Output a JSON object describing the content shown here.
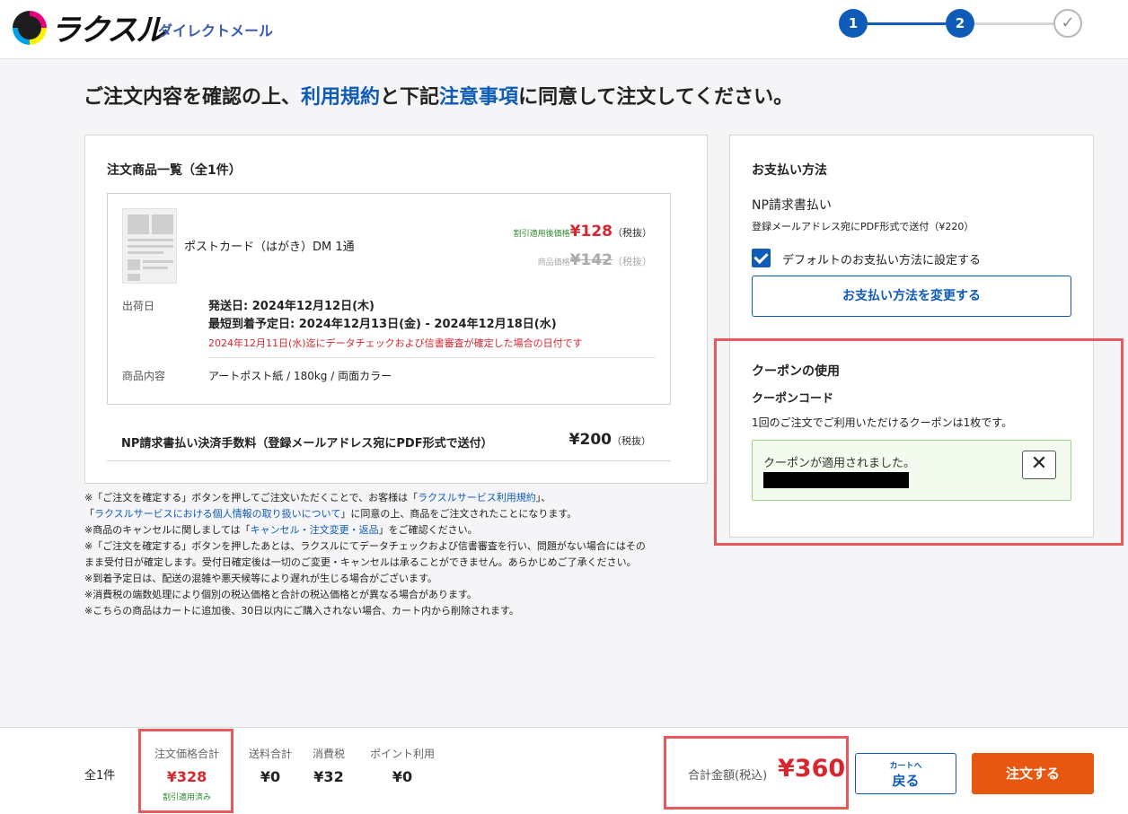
{
  "header": {
    "logo_text": "ラクスル",
    "logo_sub": "ダイレクトメール",
    "steps": [
      "1",
      "2",
      "✓"
    ]
  },
  "title": {
    "prefix": "ご注文内容を確認の上、",
    "link1": "利用規約",
    "mid": "と下記",
    "link2": "注意事項",
    "suffix": "に同意して注文してください。"
  },
  "order": {
    "heading": "注文商品一覧（全1件）",
    "item_name": "ポストカード（はがき）DM 1通",
    "discount_label": "割引適用後価格",
    "discount_price": "¥128",
    "tax_label": "（税抜）",
    "orig_label": "商品価格",
    "orig_price": "¥142",
    "ship_label": "出荷日",
    "ship_date": "発送日: 2024年12月12日(木)",
    "arrival_date": "最短到着予定日: 2024年12月13日(金) - 2024年12月18日(水)",
    "ship_note": "2024年12月11日(水)迄にデータチェックおよび信書審査が確定した場合の日付です",
    "content_label": "商品内容",
    "content_value": "アートポスト紙 / 180kg / 両面カラー",
    "fee_label": "NP請求書払い決済手数料（登録メールアドレス宛にPDF形式で送付）",
    "fee_value": "¥200",
    "fee_tax": "（税抜）"
  },
  "notes": {
    "l1a": "※「ご注文を確定する」ボタンを押してご注文いただくことで、お客様は「",
    "l1link": "ラクスルサービス利用規約",
    "l1b": "」、",
    "l2a": "「",
    "l2link": "ラクスルサービスにおける個人情報の取り扱いについて",
    "l2b": "」に同意の上、商品をご注文されたことになります。",
    "l3a": "※商品のキャンセルに関しましては「",
    "l3link": "キャンセル・注文変更・返品",
    "l3b": "」をご確認ください。",
    "l4": "※「ご注文を確定する」ボタンを押したあとは、ラクスルにてデータチェックおよび信書審査を行い、問題がない場合にはその",
    "l5": "まま受付日が確定します。受付日確定後は一切のご変更・キャンセルは承ることができません。あらかじめご了承ください。",
    "l6": "※到着予定日は、配送の混雑や悪天候等により遅れが生じる場合がございます。",
    "l7": "※消費税の端数処理により個別の税込価格と合計の税込価格とが異なる場合があります。",
    "l8": "※こちらの商品はカートに追加後、30日以内にご購入されない場合、カート内から削除されます。"
  },
  "payment": {
    "heading": "お支払い方法",
    "method": "NP請求書払い",
    "detail": "登録メールアドレス宛にPDF形式で送付（¥220）",
    "default_label": "デフォルトのお支払い方法に設定する",
    "default_checked": true,
    "change_button": "お支払い方法を変更する"
  },
  "coupon": {
    "heading": "クーポンの使用",
    "code_label": "クーポンコード",
    "desc": "1回のご注文でご利用いただけるクーポンは1枚です。",
    "applied_msg": "クーポンが適用されました。",
    "close": "✕"
  },
  "footer": {
    "count": "全1件",
    "subtotal_label": "注文価格合計",
    "subtotal_value": "¥328",
    "subtotal_note": "割引適用済み",
    "shipping_label": "送料合計",
    "shipping_value": "¥0",
    "tax_label": "消費税",
    "tax_value": "¥32",
    "points_label": "ポイント利用",
    "points_value": "¥0",
    "total_label": "合計金額(税込)",
    "total_value": "¥360",
    "back_small": "カートへ",
    "back_big": "戻る",
    "order_button": "注文する"
  },
  "colors": {
    "accent": "#0e5bb8",
    "price_red": "#d8262e",
    "order_orange": "#e8570f",
    "highlight": "#e8595c"
  }
}
